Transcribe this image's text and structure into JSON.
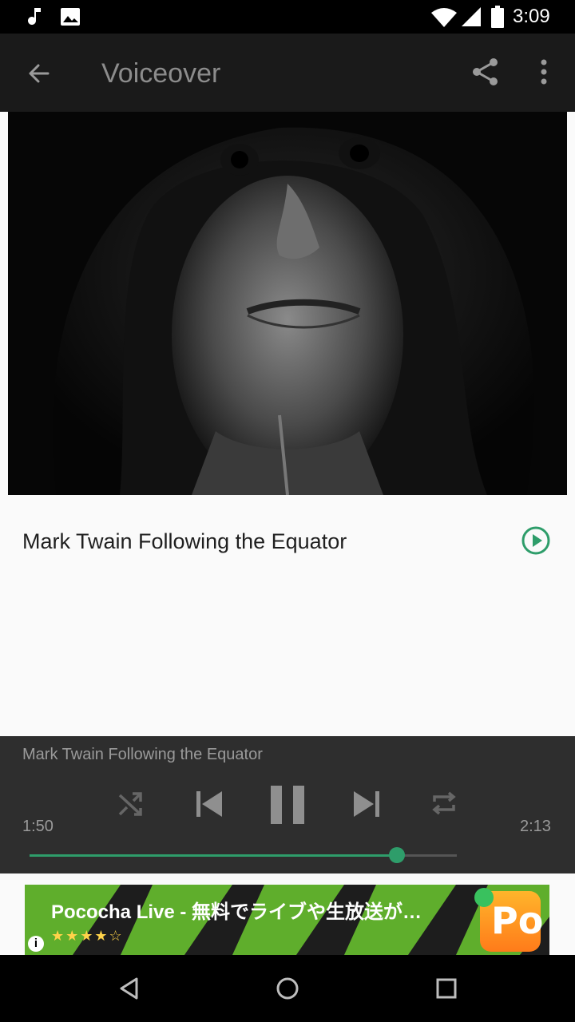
{
  "status_bar": {
    "time": "3:09",
    "icons": [
      "music-note-icon",
      "image-icon",
      "wifi-icon",
      "signal-icon",
      "battery-icon"
    ]
  },
  "toolbar": {
    "title": "Voiceover",
    "icons": [
      "back-arrow-icon",
      "share-icon",
      "more-vert-icon"
    ]
  },
  "track": {
    "title": "Mark Twain Following the Equator",
    "accent_color": "#2e9d6a"
  },
  "player": {
    "now_playing": "Mark Twain Following the Equator",
    "elapsed": "1:50",
    "duration": "2:13",
    "progress": 0.86,
    "controls": [
      "shuffle-icon",
      "skip-previous-icon",
      "pause-icon",
      "skip-next-icon",
      "repeat-icon"
    ]
  },
  "ad": {
    "text": "Pococha Live - 無料でライブや生放送が…",
    "rating_stars": "★★★★☆",
    "info": "i",
    "app_icon_text": "Po"
  },
  "colors": {
    "toolbar_bg": "#1a1a1a",
    "player_bg": "#2e2e2e",
    "accent": "#2e9d6a"
  }
}
